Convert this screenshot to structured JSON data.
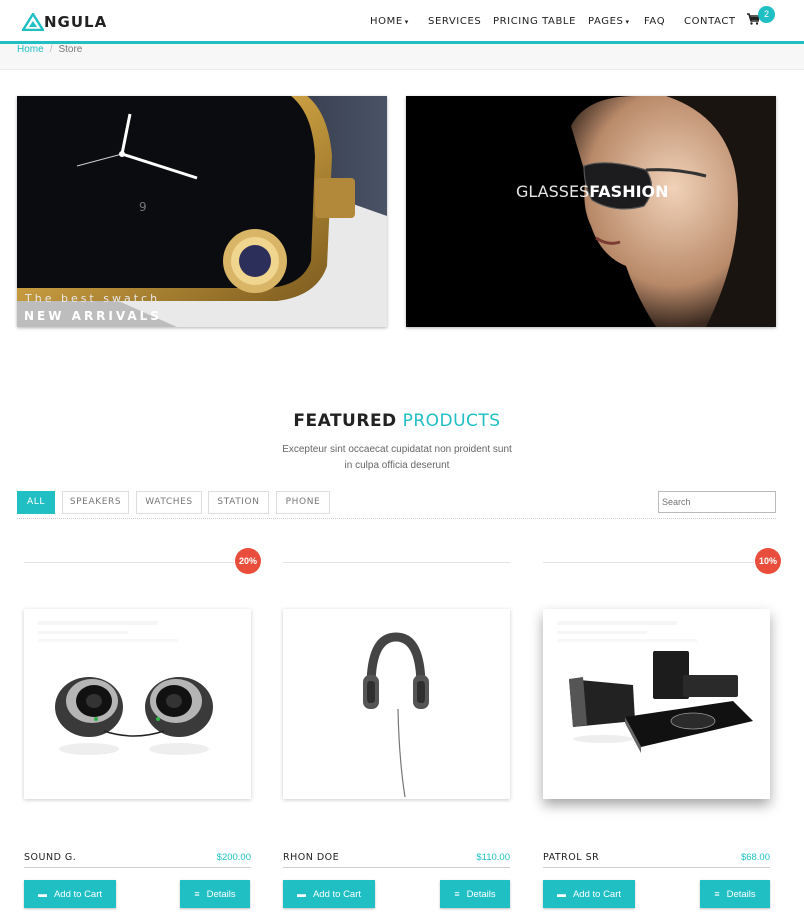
{
  "brand": {
    "logo_text": "NGULA"
  },
  "nav": {
    "items": [
      {
        "label": "HOME",
        "caret": "▾"
      },
      {
        "label": "SERVICES"
      },
      {
        "label": "PRICING TABLE"
      },
      {
        "label": "PAGES",
        "caret": "▾"
      },
      {
        "label": "FAQ"
      },
      {
        "label": "CONTACT"
      }
    ],
    "cart_count": "2"
  },
  "breadcrumb": {
    "home": "Home",
    "separator": "/",
    "current": "Store"
  },
  "banners": {
    "left": {
      "subtitle": "The best swatch",
      "title": "NEW ARRIVALS"
    },
    "right": {
      "title_light": "GLASSES",
      "title_bold": "FASHION"
    }
  },
  "featured": {
    "title_bold": "FEATURED",
    "title_accent": "PRODUCTS",
    "line1": "Excepteur sint occaecat cupidatat non proident sunt",
    "line2": "in culpa officia deserunt"
  },
  "filters": {
    "items": [
      "ALL",
      "SPEAKERS",
      "WATCHES",
      "STATION",
      "PHONE"
    ],
    "active": "ALL",
    "search_placeholder": "Search"
  },
  "products": [
    {
      "name": "SOUND G.",
      "price": "$200.00",
      "badge": "20%",
      "add_label": "Add to Cart",
      "details_label": "Details"
    },
    {
      "name": "RHON DOE",
      "price": "$110.00",
      "badge": "",
      "add_label": "Add to Cart",
      "details_label": "Details"
    },
    {
      "name": "PATROL SR",
      "price": "$68.00",
      "badge": "10%",
      "add_label": "Add to Cart",
      "details_label": "Details"
    }
  ],
  "colors": {
    "accent": "#1fbfc4",
    "badge": "#e94e3c"
  }
}
